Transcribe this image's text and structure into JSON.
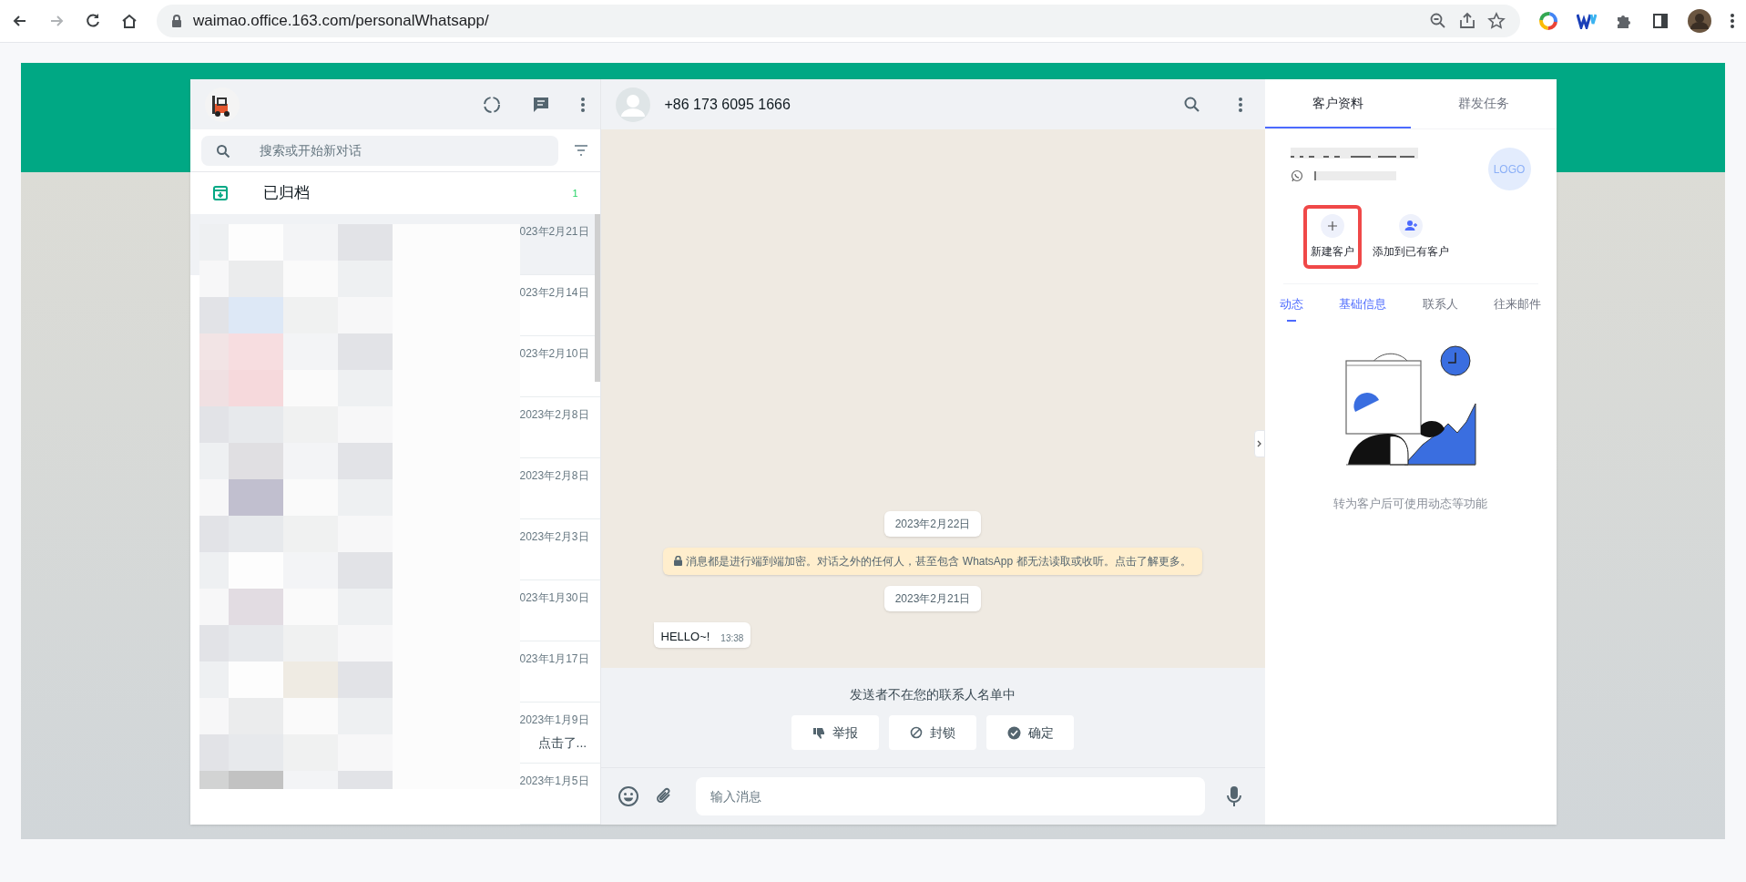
{
  "browser": {
    "url": "waimao.office.163.com/personalWhatsapp/"
  },
  "chat_list": {
    "search_placeholder": "搜索或开始新对话",
    "archived": {
      "label": "已归档",
      "count": "1"
    },
    "chats": [
      {
        "date": "023年2月21日",
        "selected": true
      },
      {
        "date": "023年2月14日",
        "selected": false
      },
      {
        "date": "023年2月10日",
        "selected": false
      },
      {
        "date": "2023年2月8日",
        "selected": false
      },
      {
        "date": "2023年2月8日",
        "selected": false
      },
      {
        "date": "2023年2月3日",
        "selected": false
      },
      {
        "date": "023年1月30日",
        "selected": false
      },
      {
        "date": "023年1月17日",
        "selected": false
      },
      {
        "date": "2023年1月9日",
        "preview": "点击了...",
        "selected": false
      },
      {
        "date": "2023年1月5日",
        "selected": false
      }
    ]
  },
  "conversation": {
    "contact": "+86 173 6095 1666",
    "messages": [
      {
        "kind": "date",
        "text": "2023年2月22日"
      },
      {
        "kind": "system",
        "text": "消息都是进行端到端加密。对话之外的任何人，甚至包含 WhatsApp 都无法读取或收听。点击了解更多。"
      },
      {
        "kind": "date",
        "text": "2023年2月21日"
      },
      {
        "kind": "incoming",
        "text": "HELLO~!",
        "time": "13:38"
      }
    ],
    "unknown_sender": {
      "text": "发送者不在您的联系人名单中",
      "buttons": [
        {
          "kind": "report",
          "label": "举报"
        },
        {
          "kind": "block",
          "label": "封锁"
        },
        {
          "kind": "ok",
          "label": "确定"
        }
      ]
    },
    "input_placeholder": "输入消息"
  },
  "customer_panel": {
    "tabs": [
      {
        "label": "客户资料",
        "selected": true
      },
      {
        "label": "群发任务",
        "selected": false
      }
    ],
    "logo": "LOGO",
    "actions": [
      {
        "kind": "new",
        "label": "新建客户",
        "highlighted": true
      },
      {
        "kind": "add",
        "label": "添加到已有客户",
        "highlighted": false
      }
    ],
    "sub_tabs": [
      {
        "label": "动态",
        "selected": true,
        "hovered": false
      },
      {
        "label": "基础信息",
        "selected": false,
        "hovered": true
      },
      {
        "label": "联系人",
        "selected": false,
        "hovered": false
      },
      {
        "label": "往来邮件",
        "selected": false,
        "hovered": false
      }
    ],
    "empty_text": "转为客户后可使用动态等功能"
  }
}
